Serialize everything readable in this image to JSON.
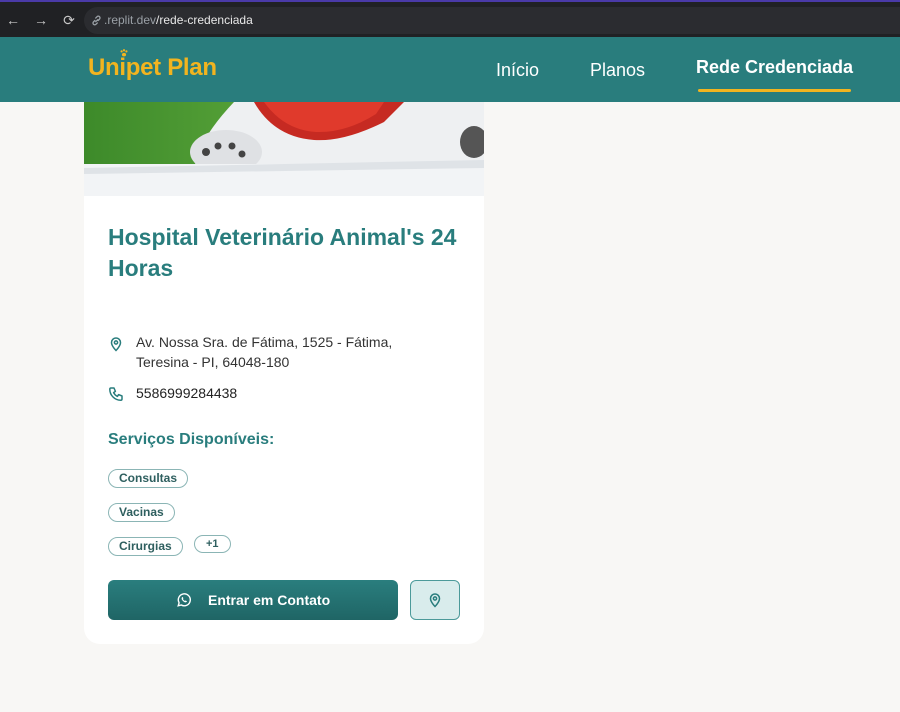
{
  "browser": {
    "url_domain": ".replit.dev",
    "url_path": "/rede-credenciada"
  },
  "header": {
    "logo": "Unipet Plan",
    "nav": {
      "inicio": "Início",
      "planos": "Planos",
      "rede": "Rede Credenciada"
    },
    "active_nav": "Rede Credenciada"
  },
  "card": {
    "title": "Hospital Veterinário Animal's 24 Horas",
    "address": "Av. Nossa Sra. de Fátima, 1525 - Fátima, Teresina - PI, 64048-180",
    "phone": "5586999284438",
    "services_title": "Serviços Disponíveis:",
    "services": [
      "Consultas",
      "Vacinas",
      "Cirurgias"
    ],
    "more_services": "+1",
    "contact_button": "Entrar em Contato"
  },
  "colors": {
    "brand_teal": "#297d7d",
    "brand_yellow": "#f2b41f",
    "background": "#f8f7f5"
  }
}
